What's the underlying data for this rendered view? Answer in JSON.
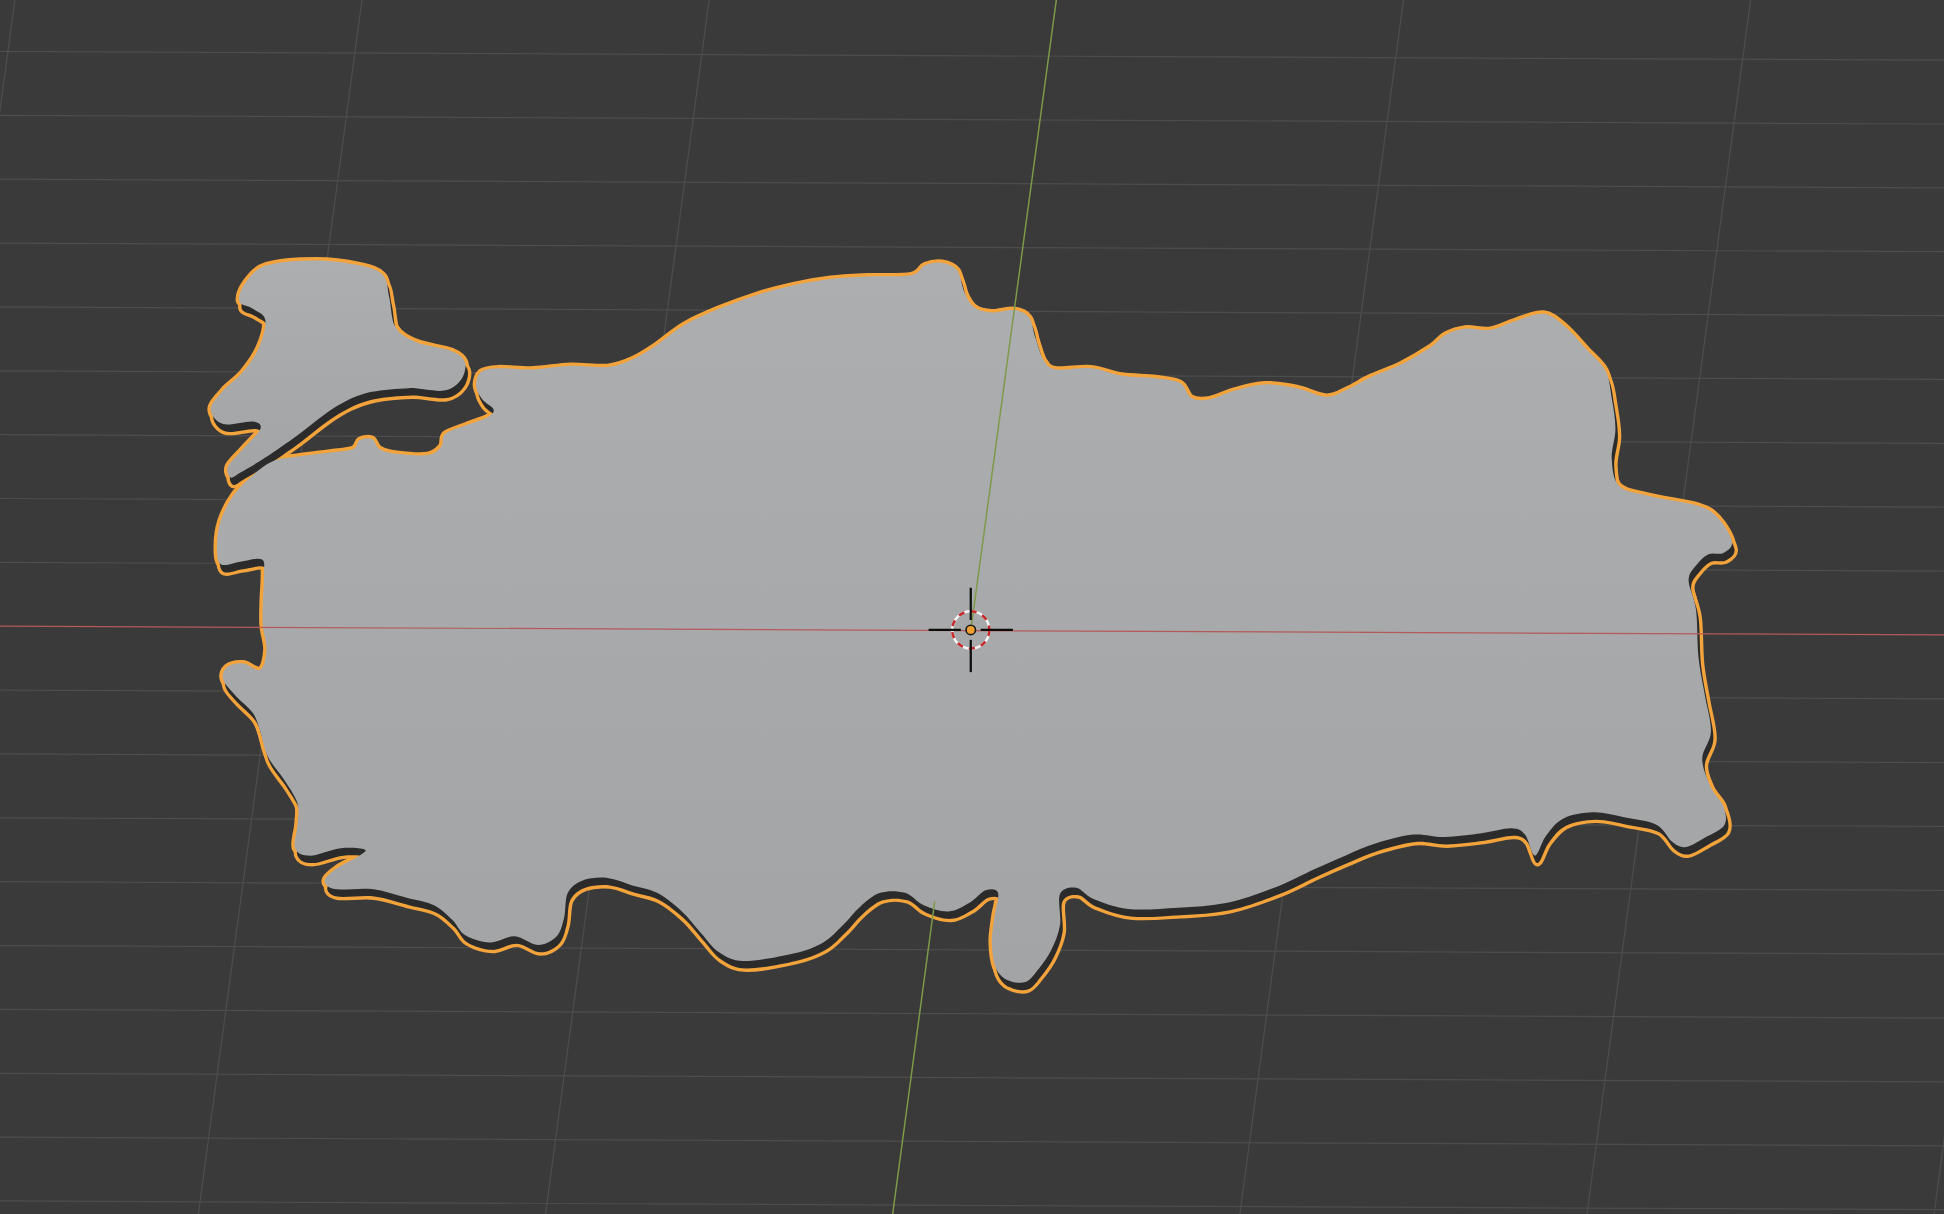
{
  "viewport": {
    "object": {
      "selected": true
    },
    "cursor_3d": {
      "visible": true
    }
  }
}
